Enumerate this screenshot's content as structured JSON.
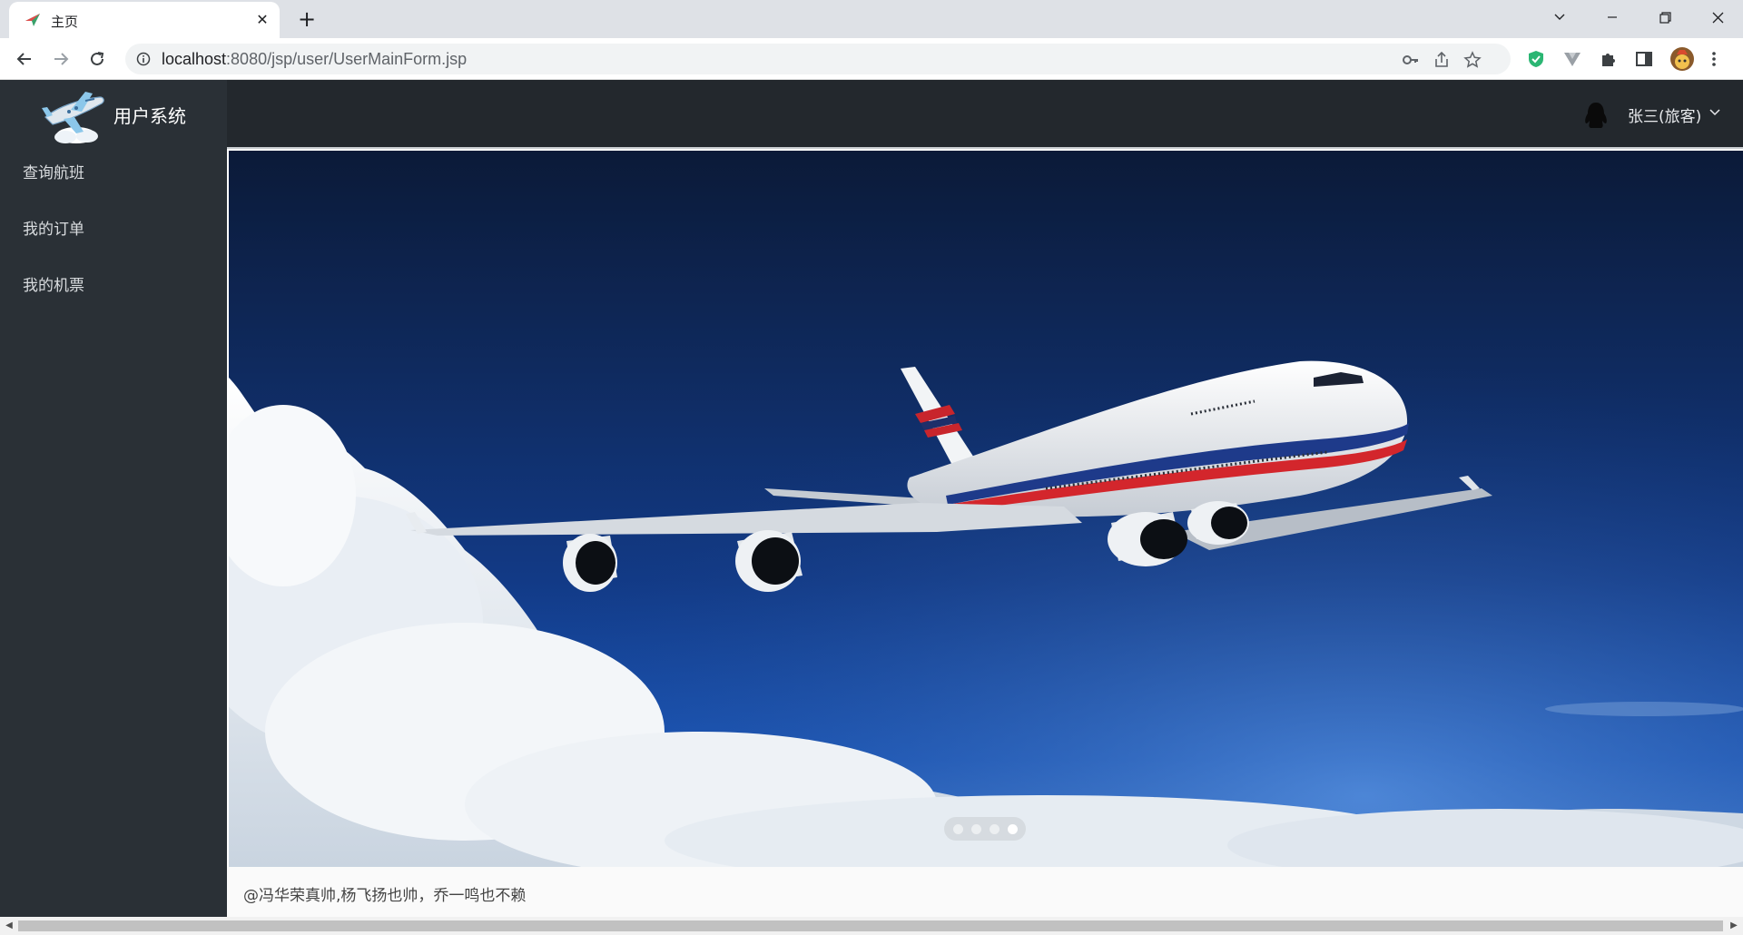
{
  "browser": {
    "tab_title": "主页",
    "url_host": "localhost",
    "url_rest": ":8080/jsp/user/UserMainForm.jsp"
  },
  "app": {
    "brand_title": "用户系统",
    "menu": [
      {
        "label": "查询航班"
      },
      {
        "label": "我的订单"
      },
      {
        "label": "我的机票"
      }
    ],
    "user_label": "张三(旅客)",
    "footer_text": "@冯华荣真帅,杨飞扬也帅，乔一鸣也不赖",
    "carousel": {
      "slides": 4,
      "active_index": 3
    }
  },
  "colors": {
    "sidebar": "#2a3036",
    "header": "#23282d",
    "sky_top": "#0b1a38",
    "sky_bottom": "#3f7ad0"
  },
  "icons": {
    "tab_favicon": "airplane-favicon-icon",
    "user_avatar": "qq-penguin-icon"
  }
}
